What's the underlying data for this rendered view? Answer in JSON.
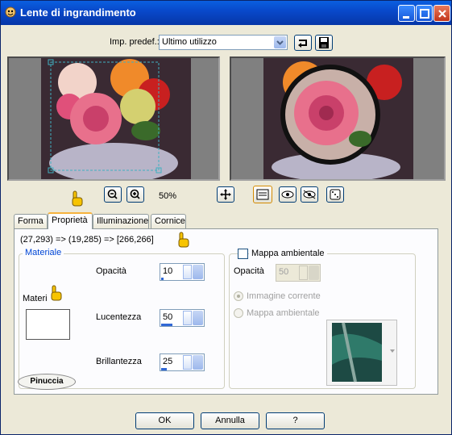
{
  "window": {
    "title": "Lente di ingrandimento"
  },
  "preset": {
    "label": "Imp. predef.:",
    "value": "Ultimo utilizzo"
  },
  "zoom": {
    "level": "50%"
  },
  "tabs": [
    {
      "label": "Forma"
    },
    {
      "label": "Proprietà"
    },
    {
      "label": "Illuminazione"
    },
    {
      "label": "Cornice"
    }
  ],
  "coords_text": "(27,293) => (19,285) => [266,266]",
  "materiale": {
    "group_title": "Materiale",
    "material_label": "Materi",
    "opacita": {
      "label": "Opacità",
      "value": "10",
      "fill": 0.1
    },
    "lucentezza": {
      "label": "Lucentezza",
      "value": "50",
      "fill": 0.5
    },
    "brillantezza": {
      "label": "Brillantezza",
      "value": "25",
      "fill": 0.25
    }
  },
  "ambientale": {
    "checkbox_label": "Mappa ambientale",
    "checked": false,
    "opacita_label": "Opacità",
    "opacita_value": "50",
    "radio_current": "Immagine corrente",
    "radio_map": "Mappa ambientale"
  },
  "watermark": "Pinuccia",
  "buttons": {
    "ok": "OK",
    "cancel": "Annulla",
    "help": "?"
  },
  "colors": {
    "title_bar": "#0847c8",
    "accent_bar": "#3168d5",
    "tab_highlight": "#f7b33d",
    "dialog_bg": "#ece9d8"
  }
}
